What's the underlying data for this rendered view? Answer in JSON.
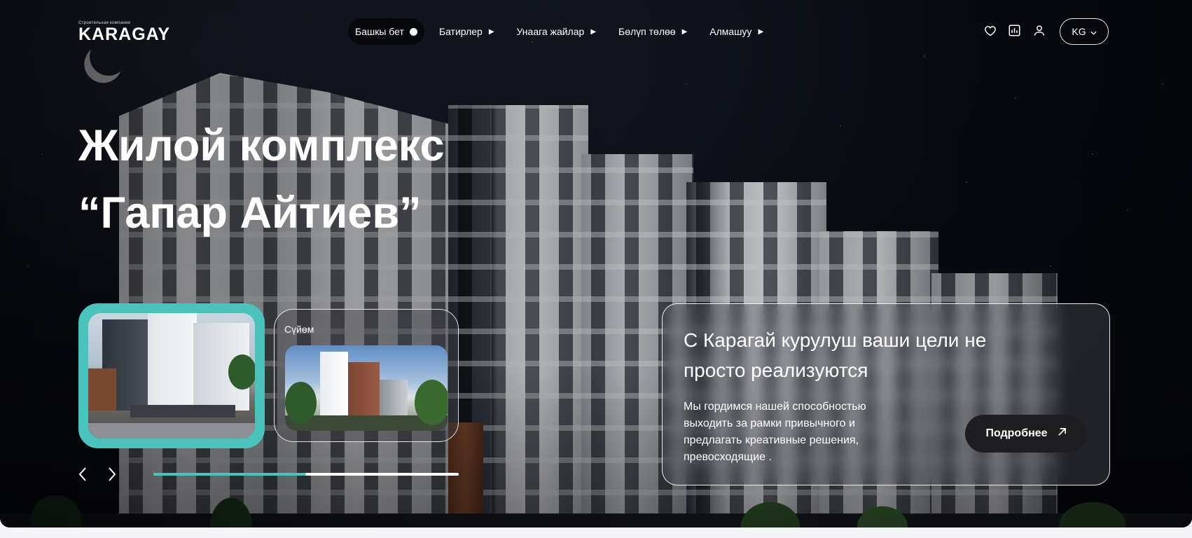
{
  "brand": {
    "subtitle": "Строительная компания",
    "name": "KARAGAY"
  },
  "nav": [
    {
      "label": "Башкы бет",
      "active": true
    },
    {
      "label": "Батирлер",
      "active": false
    },
    {
      "label": "Унаага жайлар",
      "active": false
    },
    {
      "label": "Бөлүп төлөө",
      "active": false
    },
    {
      "label": "Алмашуу",
      "active": false
    }
  ],
  "header_icons": [
    "heart-icon",
    "chart-icon",
    "user-icon"
  ],
  "language": {
    "current": "KG"
  },
  "hero": {
    "title_line1": "Жилой комплекс",
    "title_line2": "“Гапар Айтиев”"
  },
  "slides": [
    {
      "label": "",
      "active": true
    },
    {
      "label": "Сүйөм",
      "active": false
    }
  ],
  "slider_progress": 0.5,
  "info_panel": {
    "title": "С Карагай курулуш ваши цели не просто реализуются",
    "text": "Мы гордимся нашей способностью выходить за рамки привычного и предлагать креативные решения, превосходящие .",
    "button_label": "Подробнее"
  },
  "colors": {
    "accent": "#4bc3bd",
    "button_bg": "#1e1e20"
  }
}
